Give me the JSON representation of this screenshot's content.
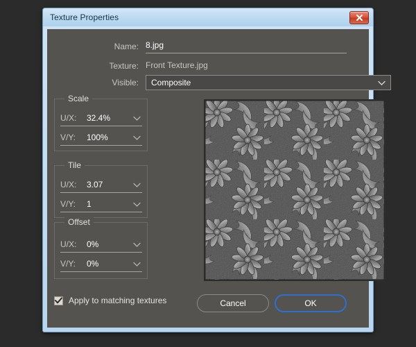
{
  "window": {
    "title": "Texture Properties",
    "close_icon": "close-x-icon"
  },
  "form": {
    "name": {
      "label": "Name:",
      "value": "8.jpg"
    },
    "texture": {
      "label": "Texture:",
      "value": "Front Texture.jpg"
    },
    "visible": {
      "label": "Visible:",
      "value": "Composite",
      "chevron_icon": "chevron-down-icon"
    }
  },
  "groups": [
    {
      "legend": "Scale",
      "fields": [
        {
          "label": "U/X:",
          "value": "32.4%"
        },
        {
          "label": "V/Y:",
          "value": "100%"
        }
      ]
    },
    {
      "legend": "Tile",
      "fields": [
        {
          "label": "U/X:",
          "value": "3.07"
        },
        {
          "label": "V/Y:",
          "value": "1"
        }
      ]
    },
    {
      "legend": "Offset",
      "fields": [
        {
          "label": "U/X:",
          "value": "0%"
        },
        {
          "label": "V/Y:",
          "value": "0%"
        }
      ]
    }
  ],
  "preview": {
    "name": "texture-preview",
    "description": "Grayscale embossed floral damask texture"
  },
  "bottom": {
    "checkbox_label": "Apply to matching textures",
    "checkbox_checked": true,
    "cancel_label": "Cancel",
    "ok_label": "OK"
  },
  "colors": {
    "title_bar": "#c3dcf2",
    "dialog_frame": "#b8d6ef",
    "panel": "#55534f",
    "close_button": "#d9563c",
    "focus_ring": "#2f6fd0",
    "desktop": "#2b2b2b"
  }
}
